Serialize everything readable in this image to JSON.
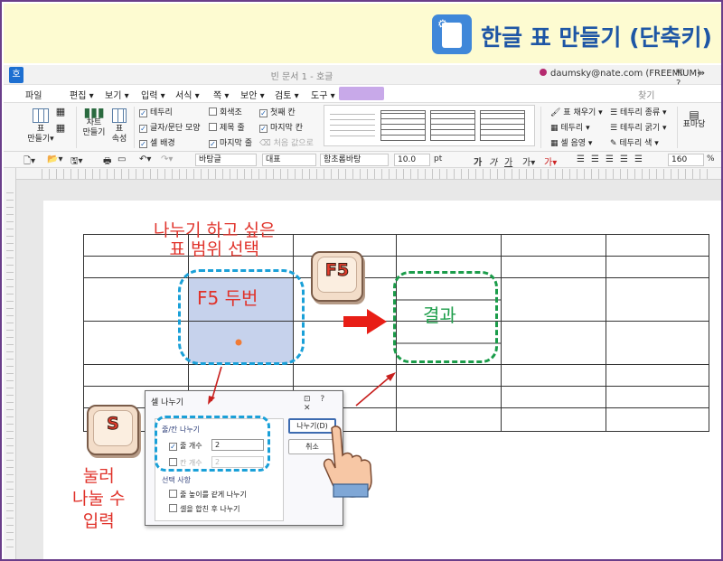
{
  "header": {
    "title": "한글 표 만들기 (단축키)"
  },
  "titlebar": {
    "app_icon": "호",
    "doc_title": "빈 문서 1 - 호글",
    "user": "daumsky@nate.com (FREEMIUM)",
    "window_buttons": "⇱ ⇹ ?"
  },
  "menubar": {
    "items": [
      "파일",
      "편집 ▾",
      "보기 ▾",
      "입력 ▾",
      "서식 ▾",
      "쪽 ▾",
      "보안 ▾",
      "검토 ▾",
      "도구 ▾"
    ],
    "right": "찾기"
  },
  "ribbon": {
    "table_btn": "표\n만들기▾",
    "chart_btn": "차트\n만들기",
    "props_btn": "표\n속성",
    "checks": [
      {
        "label": "테두리",
        "checked": true
      },
      {
        "label": "글자/문단 모양",
        "checked": true
      },
      {
        "label": "셀 배경",
        "checked": true
      },
      {
        "label": "회색조",
        "checked": false
      },
      {
        "label": "제목 줄",
        "checked": false
      },
      {
        "label": "마지막 줄",
        "checked": true
      },
      {
        "label": "첫째 칸",
        "checked": true
      },
      {
        "label": "마지막 칸",
        "checked": true
      },
      {
        "label": "처음 값으로",
        "checked": false
      }
    ],
    "right_items": [
      "표 채우기 ▾",
      "테두리 ▾",
      "셀 음영 ▾",
      "테두리 종류 ▾",
      "테두리 굵기 ▾",
      "테두리 색 ▾"
    ],
    "table_shape": "표마당"
  },
  "toolbar": {
    "style": "바탕글",
    "rep": "대표",
    "font": "함초롬바탕",
    "size": "10.0",
    "unit": "pt",
    "zoom": "160",
    "zoom_unit": "%"
  },
  "annotations": {
    "select_range": "나누기 하고 싶은\n표 범위 선택",
    "f5_twice": "F5 두번",
    "result": "결과",
    "press_enter": "눌러\n나눌 수\n입력"
  },
  "keys": {
    "f5": "F5",
    "s": "S"
  },
  "dialog": {
    "title": "셀 나누기",
    "controls": "⊡ ? ✕",
    "group_label": "줄/칸 나누기",
    "row_label": "줄 개수",
    "row_value": "2",
    "row_checked": true,
    "col_label": "칸 개수",
    "col_value": "2",
    "col_checked": false,
    "options_label": "선택 사항",
    "opt1": "줄 높이를 같게 나누기",
    "opt2": "셀을 합친 후 나누기",
    "ok": "나누기(D)",
    "cancel": "취소"
  },
  "colors": {
    "annot_red": "#e0322a",
    "result_green": "#1e9e4b",
    "dash_blue": "#1aa0d8",
    "dash_green": "#1b9c4a",
    "header_blue": "#1e56a5"
  }
}
